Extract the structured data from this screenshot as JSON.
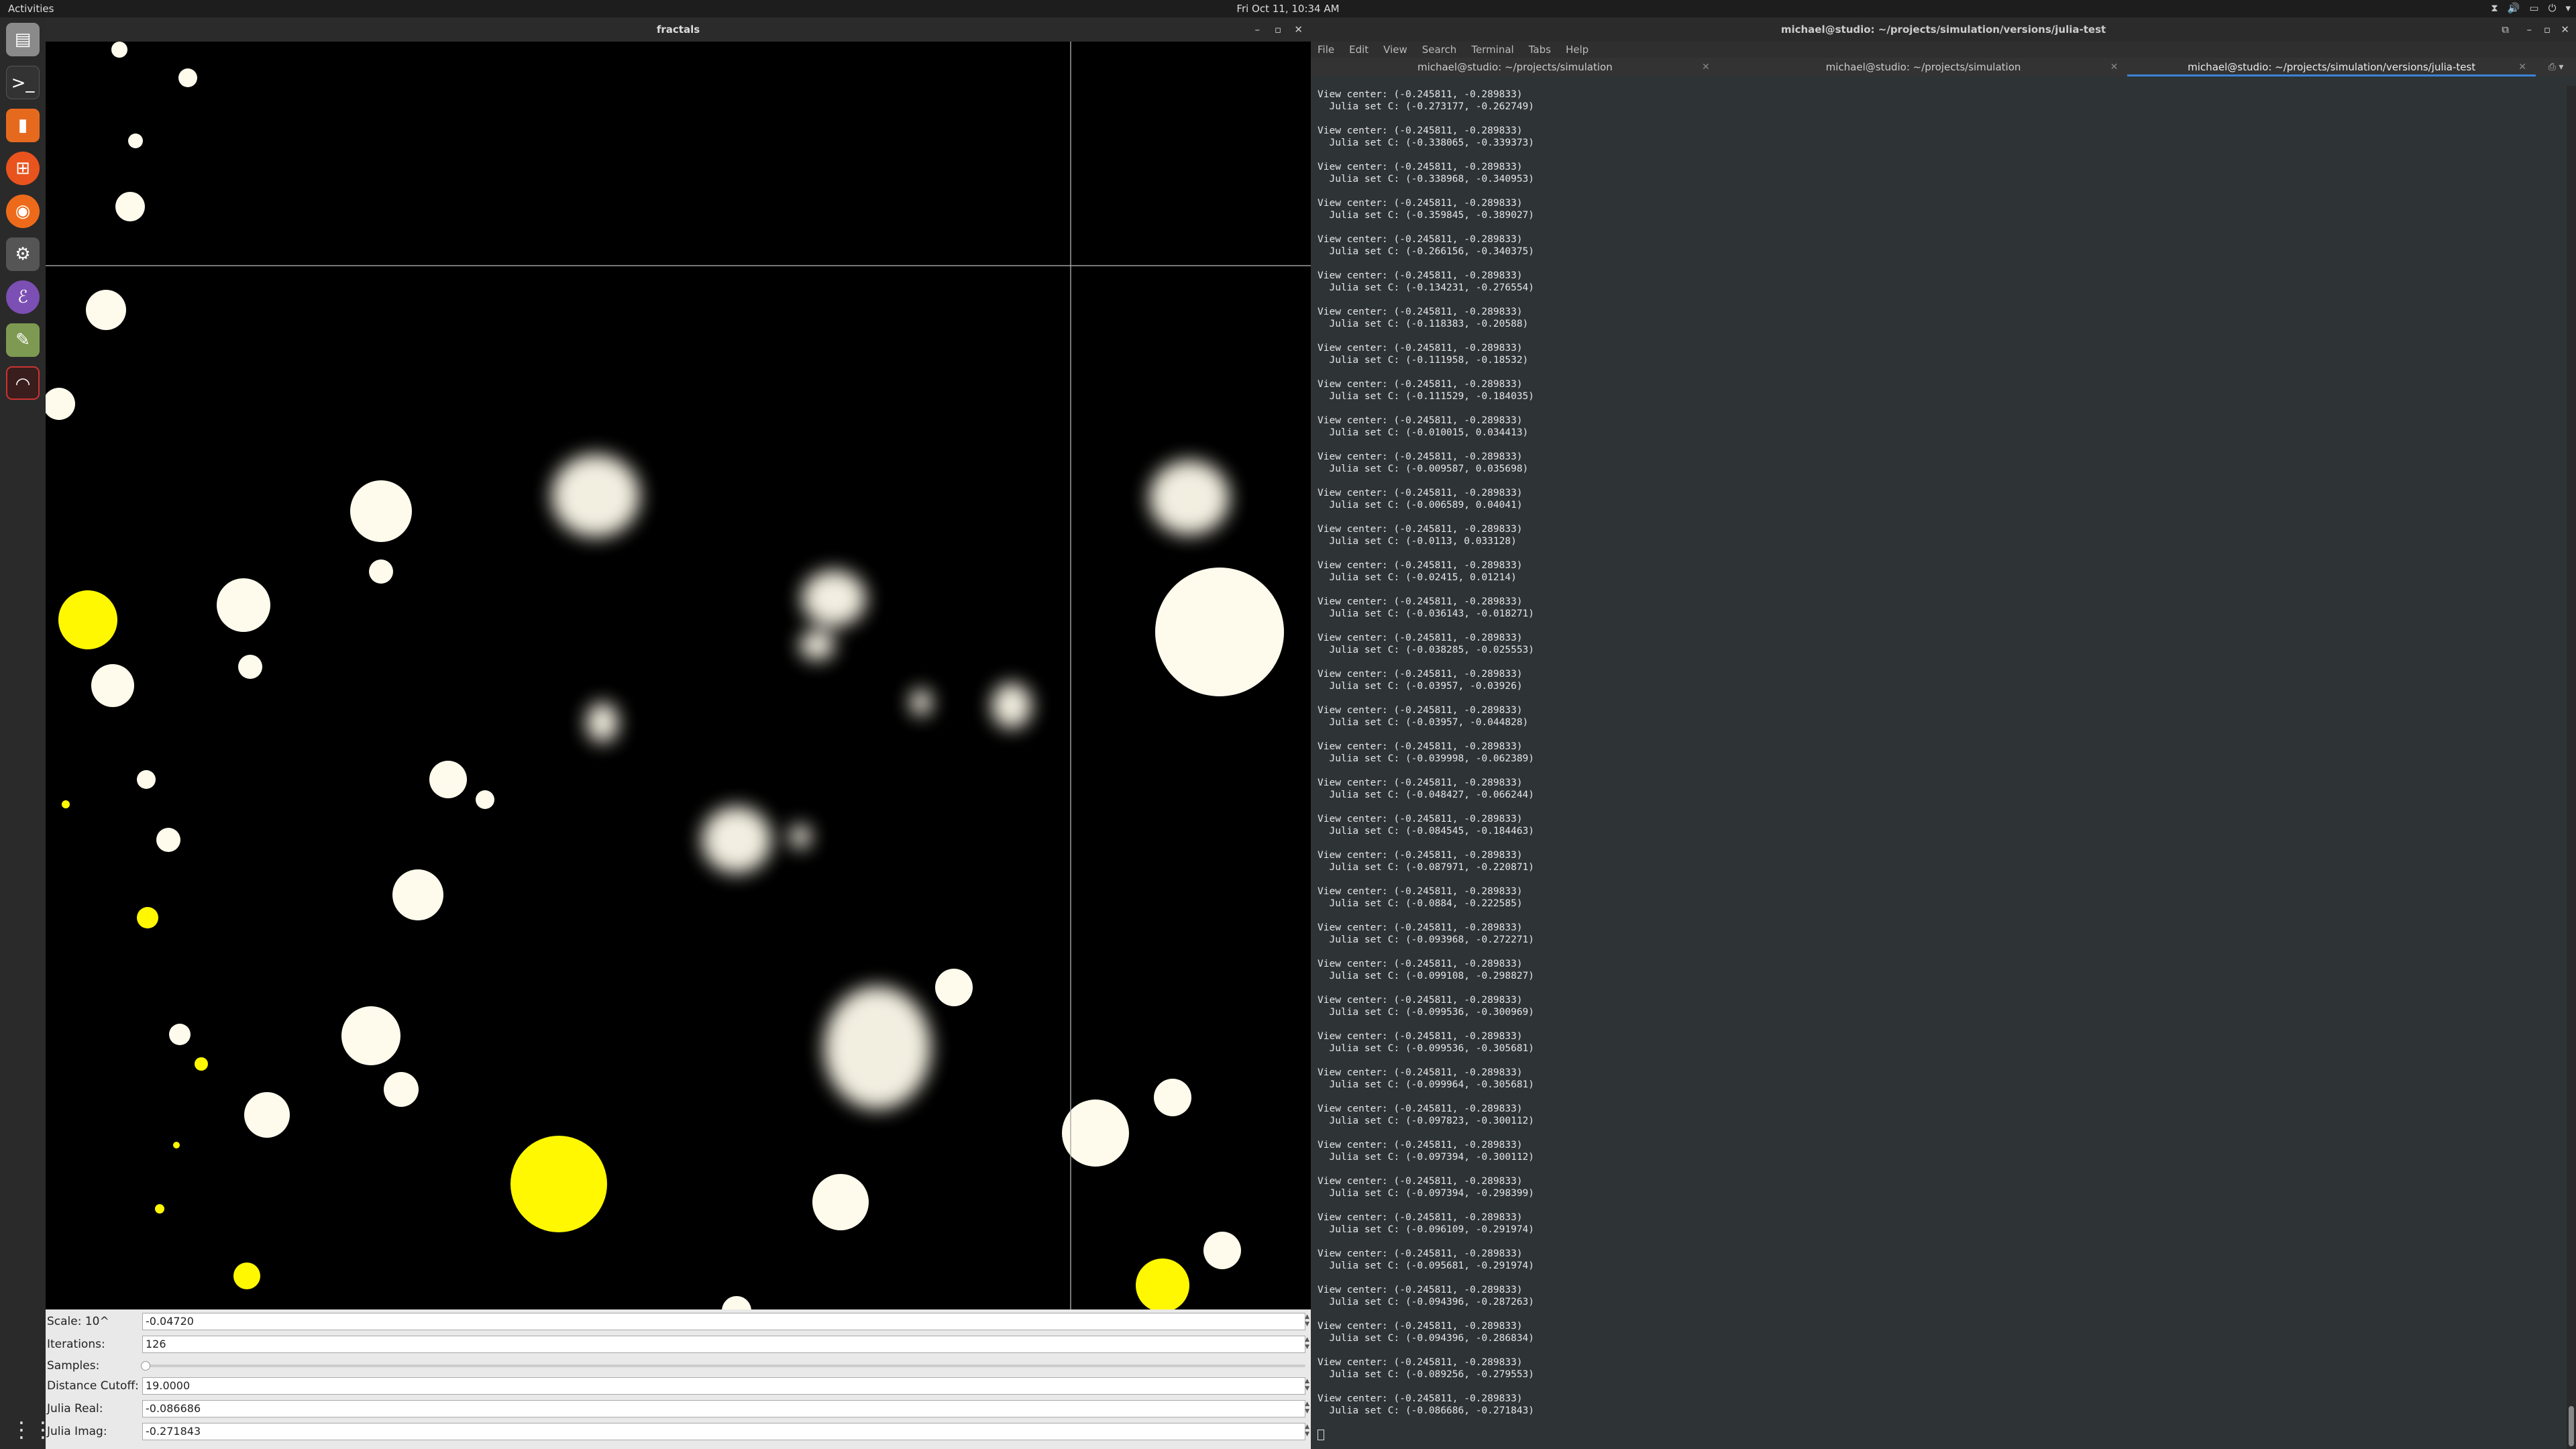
{
  "topbar": {
    "activities": "Activities",
    "clock": "Fri Oct 11, 10:34 AM"
  },
  "dock": {
    "items": [
      "files-icon",
      "terminal-icon",
      "app-icon",
      "ubuntu-software-icon",
      "firefox-icon",
      "settings-icon",
      "emacs-icon",
      "text-editor-icon",
      "fractals-app-icon"
    ]
  },
  "fractals": {
    "title": "fractals",
    "controls": {
      "scale_label": "Scale: 10^",
      "scale_value": "-0.04720",
      "iterations_label": "Iterations:",
      "iterations_value": "126",
      "samples_label": "Samples:",
      "cutoff_label": "Distance Cutoff:",
      "cutoff_value": "19.0000",
      "jreal_label": "Julia Real:",
      "jreal_value": "-0.086686",
      "jimag_label": "Julia Imag:",
      "jimag_value": "-0.271843"
    }
  },
  "terminal": {
    "title": "michael@studio: ~/projects/simulation/versions/julia-test",
    "menu": [
      "File",
      "Edit",
      "View",
      "Search",
      "Terminal",
      "Tabs",
      "Help"
    ],
    "tabs": [
      "michael@studio: ~/projects/simulation",
      "michael@studio: ~/projects/simulation",
      "michael@studio: ~/projects/simulation/versions/julia-test"
    ],
    "view_center": "View center: (-0.245811, -0.289833)",
    "julia_values": [
      "(-0.273177, -0.262749)",
      "(-0.338065, -0.339373)",
      "(-0.338968, -0.340953)",
      "(-0.359845, -0.389027)",
      "(-0.266156, -0.340375)",
      "(-0.134231, -0.276554)",
      "(-0.118383, -0.20588)",
      "(-0.111958, -0.18532)",
      "(-0.111529, -0.184035)",
      "(-0.010015, 0.034413)",
      "(-0.009587, 0.035698)",
      "(-0.006589, 0.04041)",
      "(-0.0113, 0.033128)",
      "(-0.02415, 0.01214)",
      "(-0.036143, -0.018271)",
      "(-0.038285, -0.025553)",
      "(-0.03957, -0.03926)",
      "(-0.03957, -0.044828)",
      "(-0.039998, -0.062389)",
      "(-0.048427, -0.066244)",
      "(-0.084545, -0.184463)",
      "(-0.087971, -0.220871)",
      "(-0.0884, -0.222585)",
      "(-0.093968, -0.272271)",
      "(-0.099108, -0.298827)",
      "(-0.099536, -0.300969)",
      "(-0.099536, -0.305681)",
      "(-0.099964, -0.305681)",
      "(-0.097823, -0.300112)",
      "(-0.097394, -0.300112)",
      "(-0.097394, -0.298399)",
      "(-0.096109, -0.291974)",
      "(-0.095681, -0.291974)",
      "(-0.094396, -0.287263)",
      "(-0.094396, -0.286834)",
      "(-0.089256, -0.279553)",
      "(-0.086686, -0.271843)"
    ]
  }
}
